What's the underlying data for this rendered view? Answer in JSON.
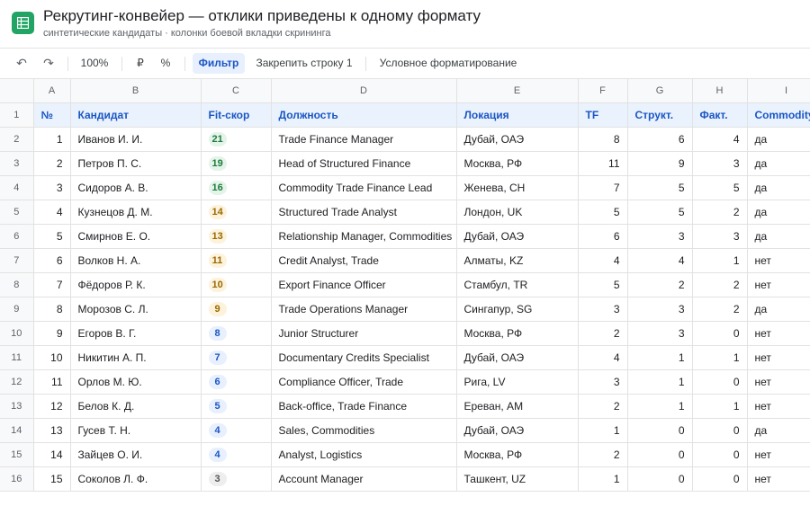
{
  "header": {
    "title": "Рекрутинг-конвейер — отклики приведены к одному формату",
    "subtitle": "синтетические кандидаты · колонки боевой вкладки скрининга"
  },
  "toolbar": {
    "undo_label": "↶",
    "redo_label": "↷",
    "zoom": "100%",
    "currency": "₽",
    "percent": "%",
    "filter": "Фильтр",
    "freeze": "Закрепить строку 1",
    "conditional": "Условное форматирование"
  },
  "sheet": {
    "col_letters": [
      "A",
      "B",
      "C",
      "D",
      "E",
      "F",
      "G",
      "H",
      "I"
    ],
    "row_numbers": [
      "1",
      "2",
      "3",
      "4",
      "5",
      "6",
      "7",
      "8",
      "9",
      "10",
      "11",
      "12",
      "13",
      "14",
      "15",
      "16"
    ],
    "headers": [
      "№",
      "Кандидат",
      "Fit-скор",
      "Должность",
      "Локация",
      "TF",
      "Структ.",
      "Факт.",
      "Commodity"
    ],
    "rows": [
      {
        "n": "1",
        "name": "Иванов И. И.",
        "fit": "21",
        "fit_level": "high",
        "position": "Trade Finance Manager",
        "location": "Дубай, ОАЭ",
        "tf": "8",
        "struct": "6",
        "fact": "4",
        "commodity": "да"
      },
      {
        "n": "2",
        "name": "Петров П. С.",
        "fit": "19",
        "fit_level": "high",
        "position": "Head of Structured Finance",
        "location": "Москва, РФ",
        "tf": "11",
        "struct": "9",
        "fact": "3",
        "commodity": "да"
      },
      {
        "n": "3",
        "name": "Сидоров А. В.",
        "fit": "16",
        "fit_level": "high",
        "position": "Commodity Trade Finance Lead",
        "location": "Женева, CH",
        "tf": "7",
        "struct": "5",
        "fact": "5",
        "commodity": "да"
      },
      {
        "n": "4",
        "name": "Кузнецов Д. М.",
        "fit": "14",
        "fit_level": "mid",
        "position": "Structured Trade Analyst",
        "location": "Лондон, UK",
        "tf": "5",
        "struct": "5",
        "fact": "2",
        "commodity": "да"
      },
      {
        "n": "5",
        "name": "Смирнов Е. О.",
        "fit": "13",
        "fit_level": "mid",
        "position": "Relationship Manager, Commodities",
        "location": "Дубай, ОАЭ",
        "tf": "6",
        "struct": "3",
        "fact": "3",
        "commodity": "да"
      },
      {
        "n": "6",
        "name": "Волков Н. А.",
        "fit": "11",
        "fit_level": "mid",
        "position": "Credit Analyst, Trade",
        "location": "Алматы, KZ",
        "tf": "4",
        "struct": "4",
        "fact": "1",
        "commodity": "нет"
      },
      {
        "n": "7",
        "name": "Фёдоров Р. К.",
        "fit": "10",
        "fit_level": "mid",
        "position": "Export Finance Officer",
        "location": "Стамбул, TR",
        "tf": "5",
        "struct": "2",
        "fact": "2",
        "commodity": "нет"
      },
      {
        "n": "8",
        "name": "Морозов С. Л.",
        "fit": "9",
        "fit_level": "mid",
        "position": "Trade Operations Manager",
        "location": "Сингапур, SG",
        "tf": "3",
        "struct": "3",
        "fact": "2",
        "commodity": "да"
      },
      {
        "n": "9",
        "name": "Егоров В. Г.",
        "fit": "8",
        "fit_level": "low",
        "position": "Junior Structurer",
        "location": "Москва, РФ",
        "tf": "2",
        "struct": "3",
        "fact": "0",
        "commodity": "нет"
      },
      {
        "n": "10",
        "name": "Никитин А. П.",
        "fit": "7",
        "fit_level": "low",
        "position": "Documentary Credits Specialist",
        "location": "Дубай, ОАЭ",
        "tf": "4",
        "struct": "1",
        "fact": "1",
        "commodity": "нет"
      },
      {
        "n": "11",
        "name": "Орлов М. Ю.",
        "fit": "6",
        "fit_level": "low",
        "position": "Compliance Officer, Trade",
        "location": "Рига, LV",
        "tf": "3",
        "struct": "1",
        "fact": "0",
        "commodity": "нет"
      },
      {
        "n": "12",
        "name": "Белов К. Д.",
        "fit": "5",
        "fit_level": "low",
        "position": "Back-office, Trade Finance",
        "location": "Ереван, AM",
        "tf": "2",
        "struct": "1",
        "fact": "1",
        "commodity": "нет"
      },
      {
        "n": "13",
        "name": "Гусев Т. Н.",
        "fit": "4",
        "fit_level": "low",
        "position": "Sales, Commodities",
        "location": "Дубай, ОАЭ",
        "tf": "1",
        "struct": "0",
        "fact": "0",
        "commodity": "да"
      },
      {
        "n": "14",
        "name": "Зайцев О. И.",
        "fit": "4",
        "fit_level": "low",
        "position": "Analyst, Logistics",
        "location": "Москва, РФ",
        "tf": "2",
        "struct": "0",
        "fact": "0",
        "commodity": "нет"
      },
      {
        "n": "15",
        "name": "Соколов Л. Ф.",
        "fit": "3",
        "fit_level": "none",
        "position": "Account Manager",
        "location": "Ташкент, UZ",
        "tf": "1",
        "struct": "0",
        "fact": "0",
        "commodity": "нет"
      }
    ]
  },
  "colors": {
    "app_icon": "#21a464",
    "header_row_bg": "#eaf2fd",
    "header_row_text": "#1a56c4",
    "fit_high": "#1e7d3c",
    "fit_mid": "#9a6a00",
    "fit_low": "#1a56c4",
    "fit_none": "#555555"
  }
}
